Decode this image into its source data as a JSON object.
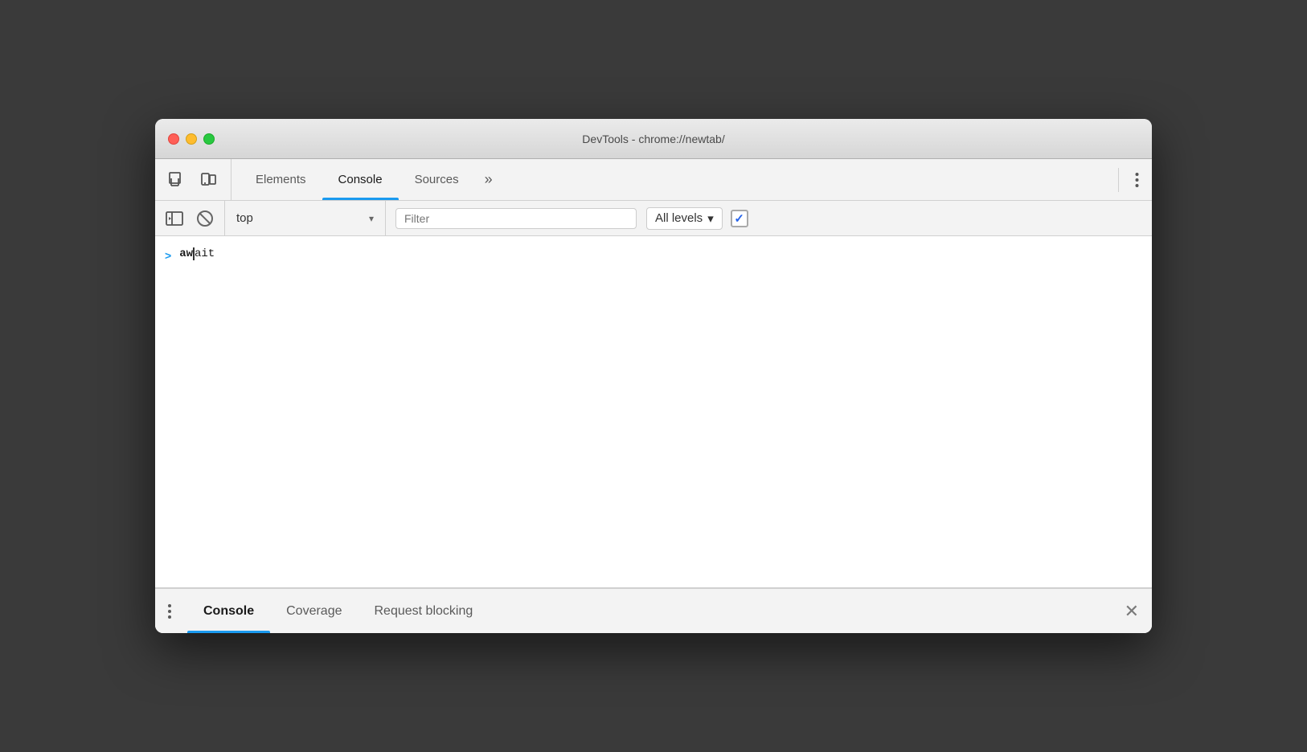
{
  "window": {
    "title": "DevTools - chrome://newtab/"
  },
  "traffic_lights": {
    "close": "close",
    "minimize": "minimize",
    "maximize": "maximize"
  },
  "top_toolbar": {
    "tabs": [
      {
        "id": "elements",
        "label": "Elements",
        "active": false
      },
      {
        "id": "console",
        "label": "Console",
        "active": true
      },
      {
        "id": "sources",
        "label": "Sources",
        "active": false
      }
    ],
    "more_tabs_label": "»",
    "menu_label": "⋮"
  },
  "console_toolbar": {
    "top_selector": {
      "value": "top",
      "dropdown_arrow": "▾"
    },
    "filter": {
      "placeholder": "Filter",
      "value": ""
    },
    "all_levels": {
      "label": "All levels",
      "arrow": "▾"
    },
    "checkbox": {
      "checked": true,
      "symbol": "✓"
    }
  },
  "console_content": {
    "entries": [
      {
        "id": "await-entry",
        "chevron": ">",
        "bold": "aw",
        "normal": "ait"
      }
    ]
  },
  "bottom_panel": {
    "tabs": [
      {
        "id": "console",
        "label": "Console",
        "active": true
      },
      {
        "id": "coverage",
        "label": "Coverage",
        "active": false
      },
      {
        "id": "request-blocking",
        "label": "Request blocking",
        "active": false
      }
    ],
    "close_label": "✕"
  }
}
